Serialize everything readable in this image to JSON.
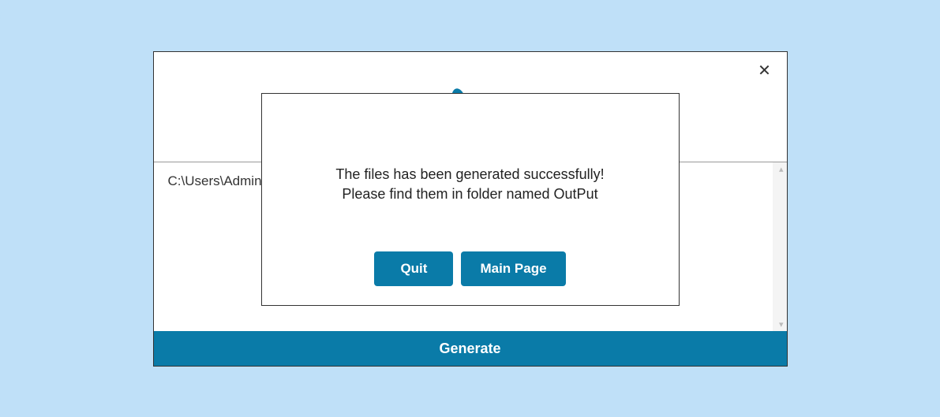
{
  "window": {
    "close_label": "✕"
  },
  "content": {
    "path_text": "C:\\Users\\Adminis"
  },
  "modal": {
    "message_line1": "The files has been generated successfully!",
    "message_line2": "Please find them in folder named OutPut",
    "quit_label": "Quit",
    "main_page_label": "Main Page"
  },
  "footer": {
    "generate_label": "Generate"
  }
}
